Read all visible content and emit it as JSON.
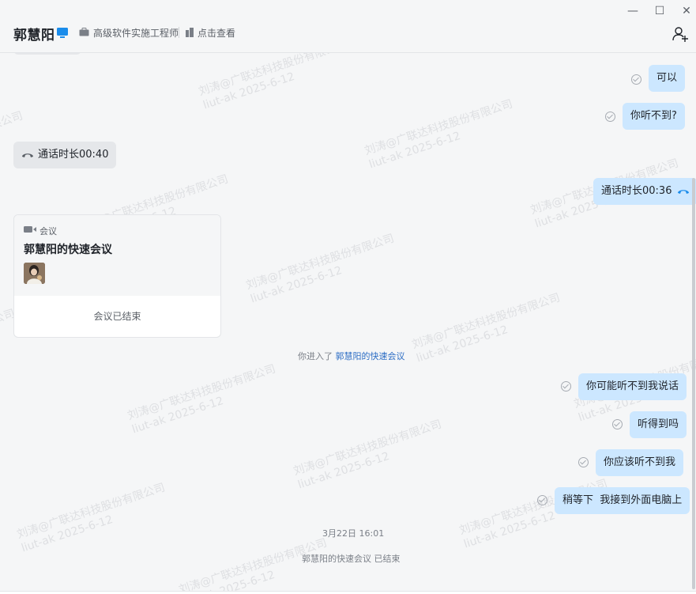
{
  "header": {
    "contact_name": "郭慧阳",
    "title_role": "高级软件实施工程师",
    "view_link": "点击查看",
    "controls": {
      "minimize": "—",
      "maximize": "☐",
      "close": "✕"
    }
  },
  "watermark": {
    "line1": "刘涛@广联达科技股份有限公司",
    "line2": "liut-ak 2025-6-12"
  },
  "messages": {
    "m1": "可以",
    "m2": "你听不到?",
    "call_in": "通话时长00:40",
    "call_out": "通话时长00:36",
    "m3": "你可能听不到我说话",
    "m4": "听得到吗",
    "m5": "你应该听不到我",
    "m6": "稍等下  我接到外面电脑上"
  },
  "meeting_card": {
    "kind": "会议",
    "title": "郭慧阳的快速会议",
    "status": "会议已结束"
  },
  "system": {
    "entered_prefix": "你进入了",
    "entered_link": "郭慧阳的快速会议",
    "timestamp": "3月22日 16:01",
    "meeting_ended": "郭慧阳的快速会议 已结束"
  },
  "colors": {
    "outgoing_bubble": "#cce7ff",
    "incoming_bubble": "#e5e7ea",
    "accent": "#1a8ceb",
    "link": "#2b6cc4"
  }
}
